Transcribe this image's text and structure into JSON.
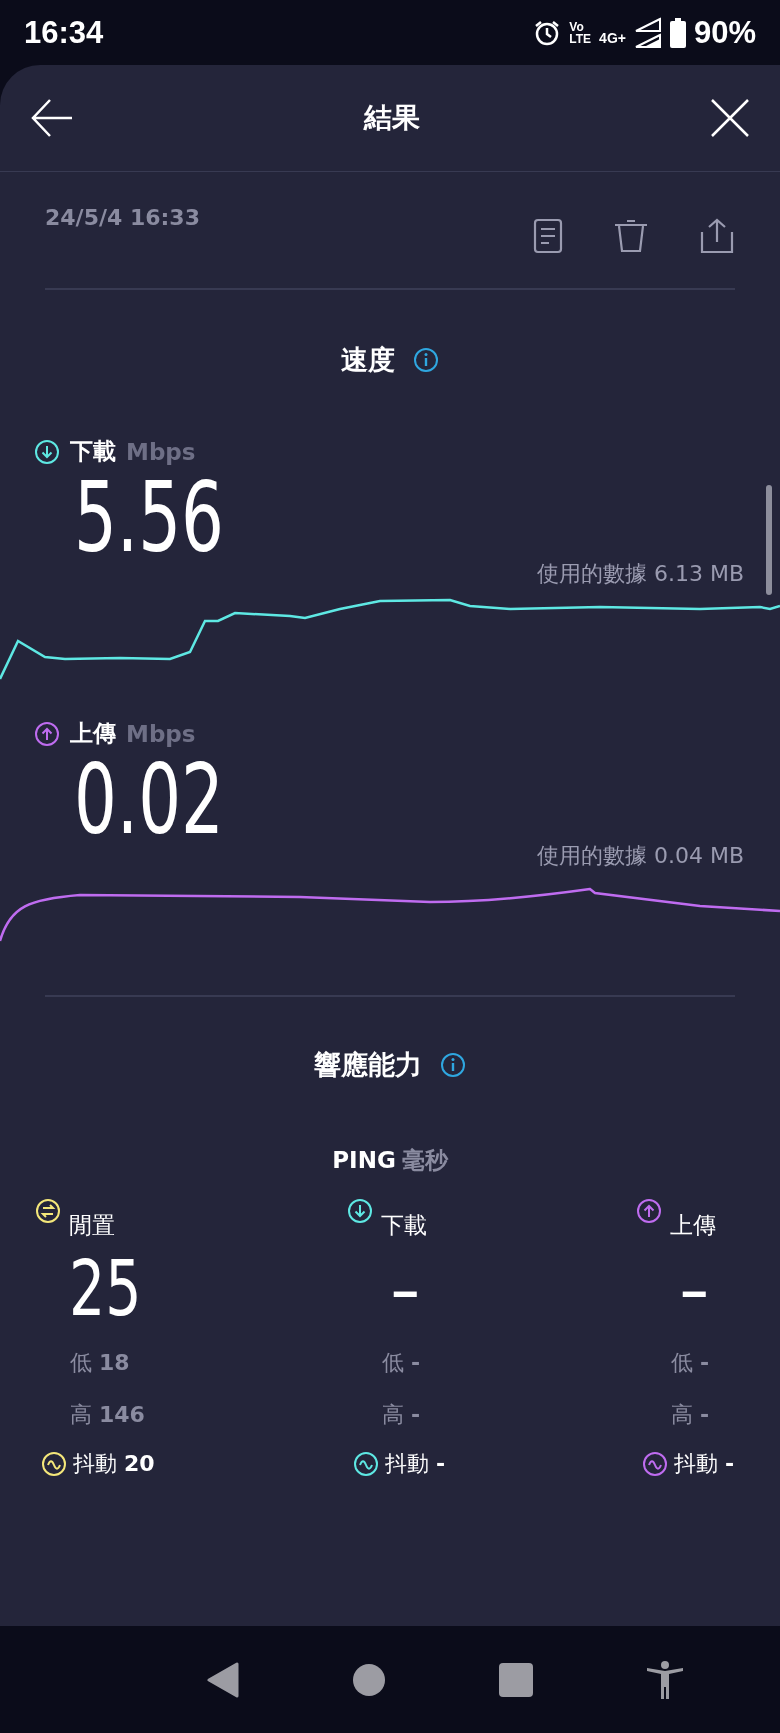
{
  "status_bar": {
    "time": "16:34",
    "volte_top": "Vo",
    "volte_bottom": "LTE",
    "network": "4G+",
    "battery": "90%"
  },
  "header": {
    "title": "結果"
  },
  "result": {
    "date": "24/5/4 16:33"
  },
  "speed": {
    "title": "速度",
    "metrics": [
      {
        "kind": "download",
        "color": "#5ee8e3",
        "label": "下載",
        "unit": "Mbps",
        "value": "5.56",
        "data_used": "使用的數據 6.13 MB"
      },
      {
        "kind": "upload",
        "color": "#bf6cf0",
        "label": "上傳",
        "unit": "Mbps",
        "value": "0.02",
        "data_used": "使用的數據 0.04 MB"
      }
    ]
  },
  "responsiveness": {
    "title": "響應能力",
    "ping_label": "PING",
    "ping_unit": "毫秒",
    "columns": [
      {
        "kind": "idle",
        "color": "#f4e77a",
        "label": "閒置",
        "value": "25",
        "low_label": "低",
        "low": "18",
        "high_label": "高",
        "high": "146",
        "jitter_label": "抖動",
        "jitter": "20"
      },
      {
        "kind": "download",
        "color": "#5ee8e3",
        "label": "下載",
        "value": "–",
        "low_label": "低",
        "low": "-",
        "high_label": "高",
        "high": "-",
        "jitter_label": "抖動",
        "jitter": "-"
      },
      {
        "kind": "upload",
        "color": "#bf6cf0",
        "label": "上傳",
        "value": "–",
        "low_label": "低",
        "low": "-",
        "high_label": "高",
        "high": "-",
        "jitter_label": "抖動",
        "jitter": "-"
      }
    ]
  }
}
